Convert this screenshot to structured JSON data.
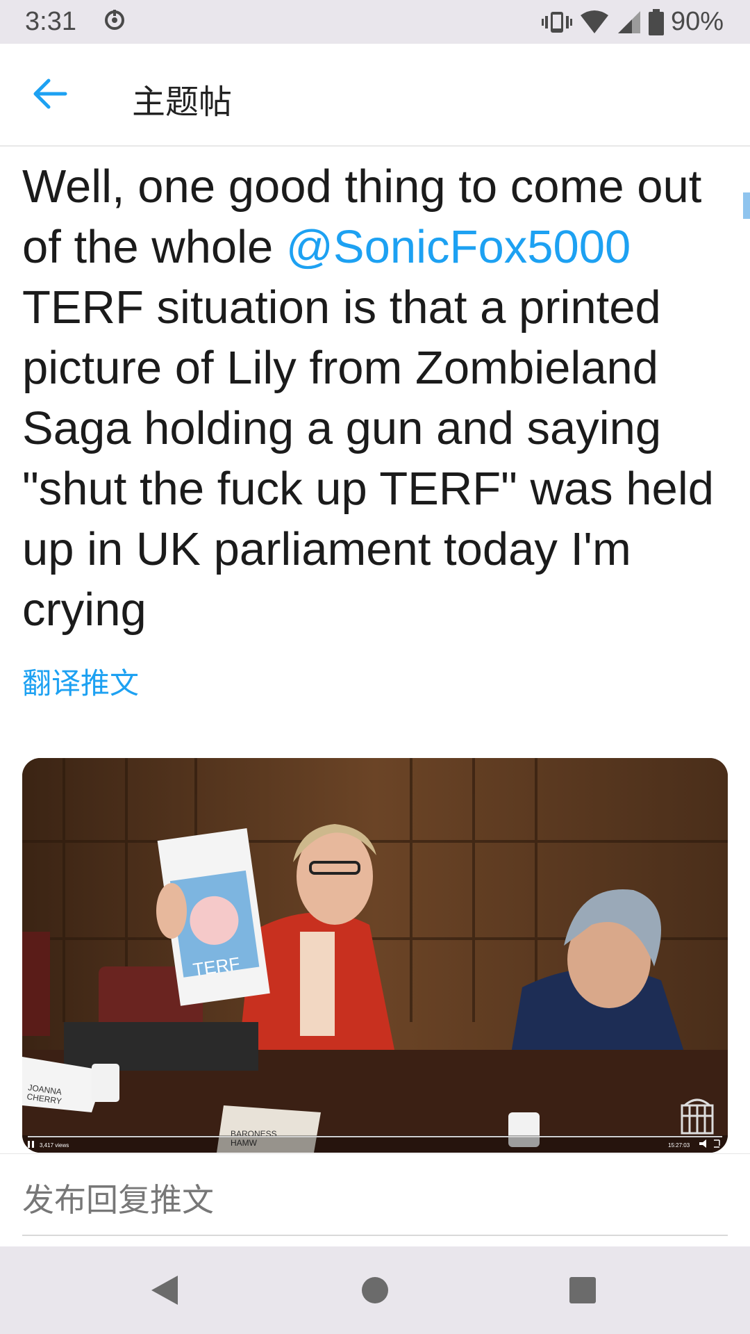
{
  "status_bar": {
    "time": "3:31",
    "battery": "90%",
    "icons": [
      "sync-icon",
      "vibrate-icon",
      "wifi-icon",
      "signal-icon",
      "battery-icon"
    ]
  },
  "header": {
    "title": "主题帖",
    "back_icon": "arrow-left-icon"
  },
  "tweet": {
    "text_before": "Well, one good thing to come out of the whole ",
    "mention": "@SonicFox5000",
    "text_after": " TERF situation is that a printed picture of Lily from Zombieland Saga holding a gun and saying \"shut the fuck up TERF\" was held up in UK parliament today I'm crying",
    "translate": "翻译推文"
  },
  "media": {
    "video_views": "3,417 views",
    "time_display": "15:27:03",
    "nameplate_left": "JOANNA\nCHERRY",
    "nameplate_center": "BARONESS\nHAMW",
    "sign_text": "TERF"
  },
  "reply": {
    "placeholder": "发布回复推文"
  },
  "colors": {
    "accent": "#1da1f2",
    "status_bar_bg": "#e9e6ec"
  }
}
